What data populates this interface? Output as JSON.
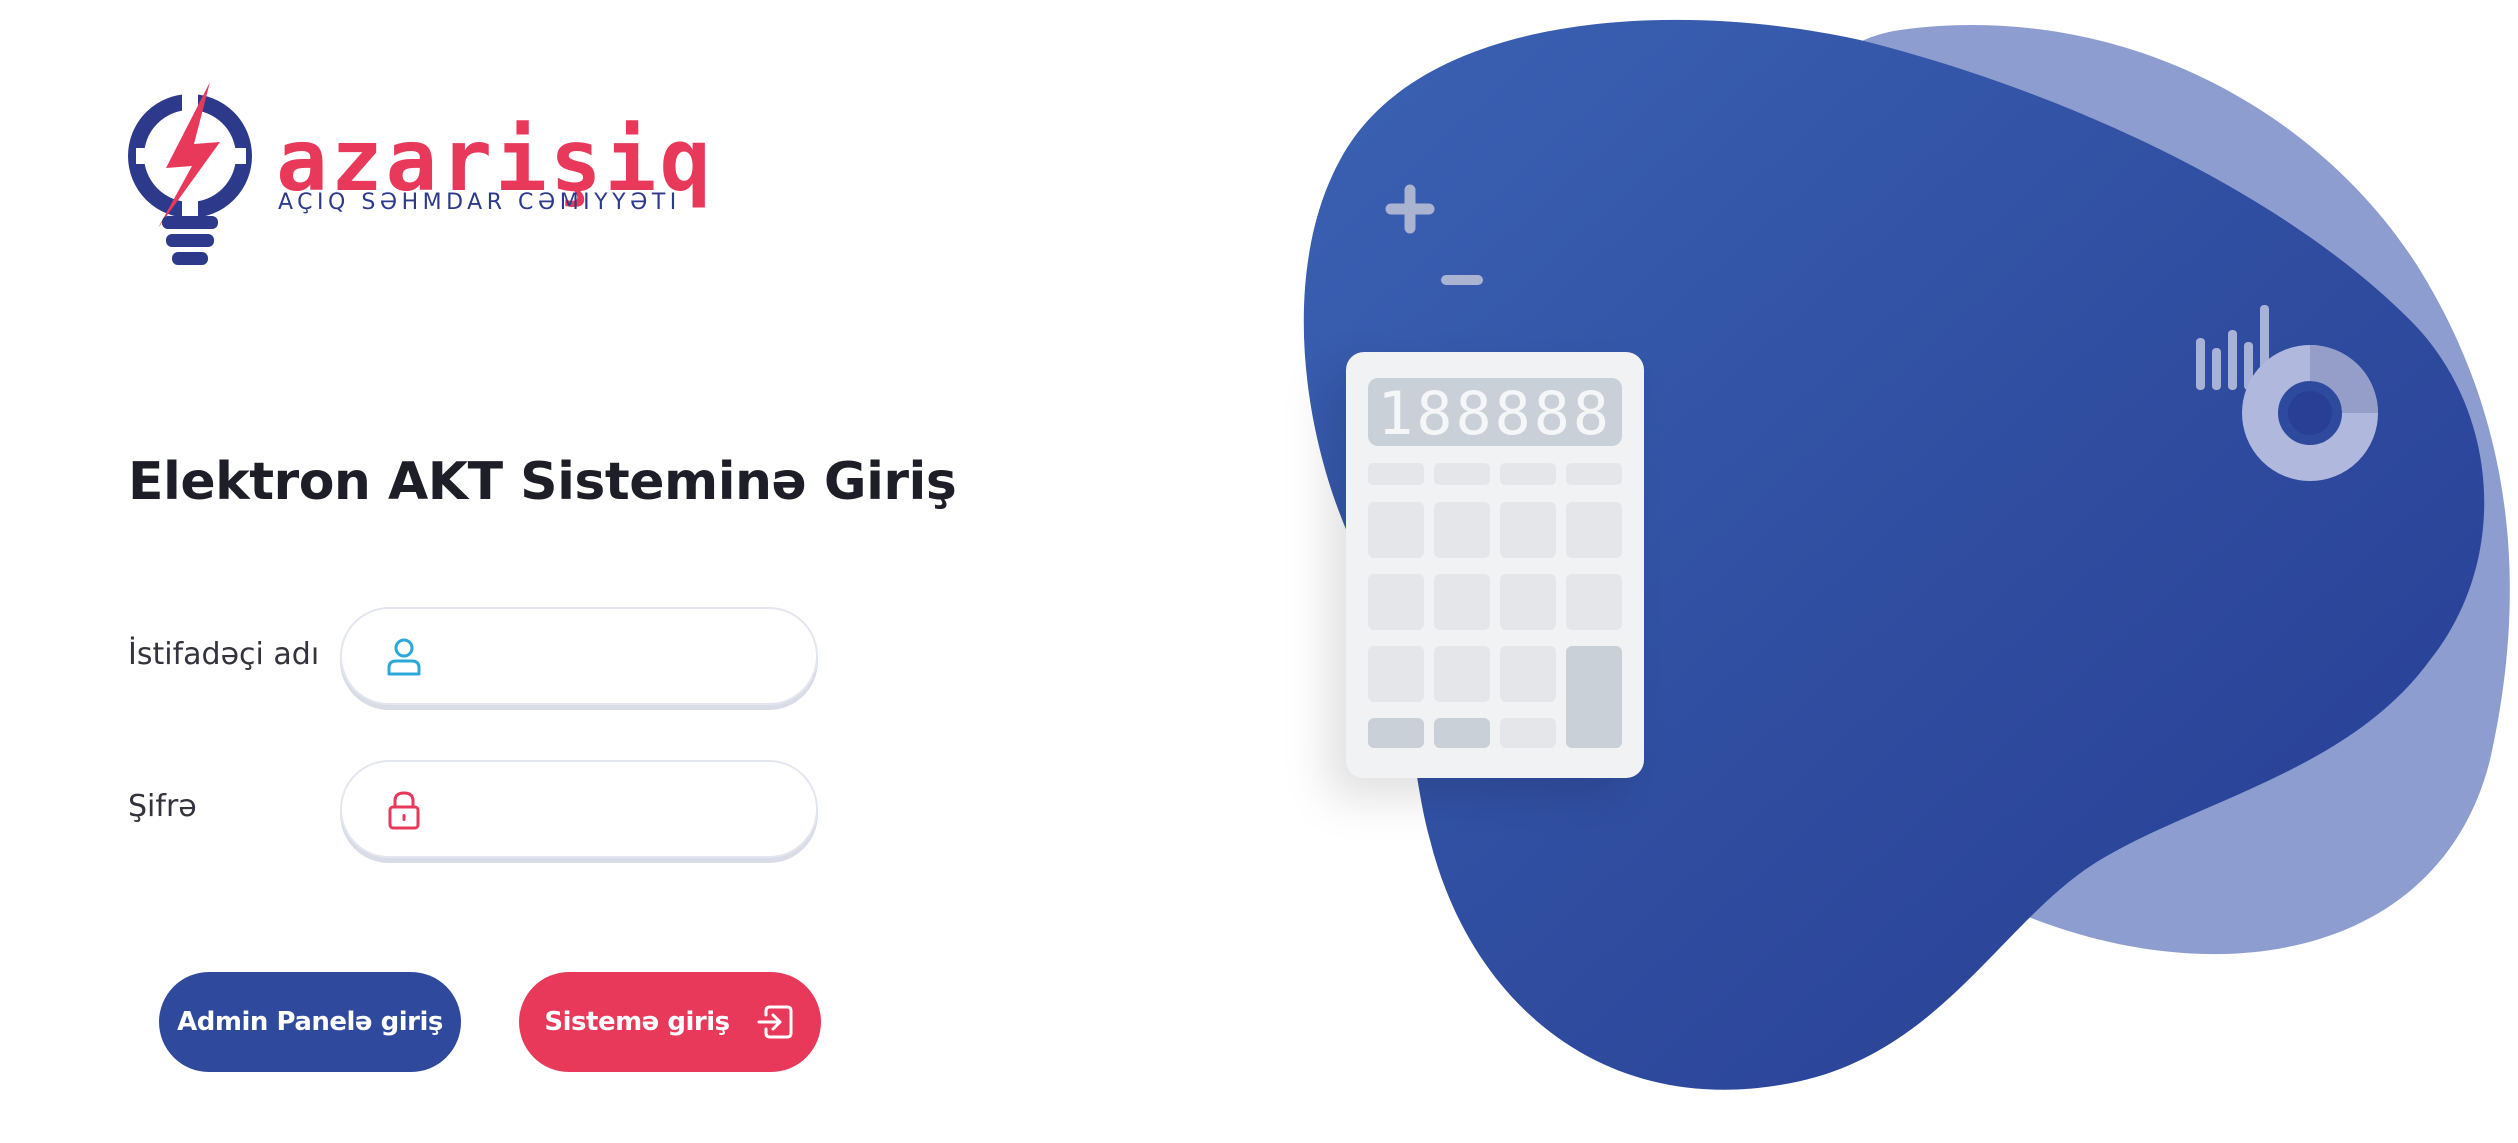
{
  "logo": {
    "wordmark": "azarişiq",
    "subtitle": "AÇIQ SƏHMDAR CƏMIYYƏTI"
  },
  "login": {
    "title": "Elektron AKT Sisteminə Giriş",
    "username_label": "İstifadəçi adı",
    "username_value": "",
    "password_label": "Şifrə",
    "password_value": "",
    "admin_button": "Admin Panelə giriş",
    "submit_button": "Sistemə giriş"
  },
  "calculator": {
    "display": "188888"
  },
  "icons": {
    "user": "user-icon",
    "password": "lock-icon",
    "submit": "sign-in-icon",
    "logo": "lightbulb-lightning-icon"
  },
  "colors": {
    "brand_blue": "#2f4a9c",
    "brand_red": "#e8395b",
    "blob_blue": "#2c4599",
    "blob_light": "#8d9dd0",
    "user_icon": "#2ba8d8"
  }
}
